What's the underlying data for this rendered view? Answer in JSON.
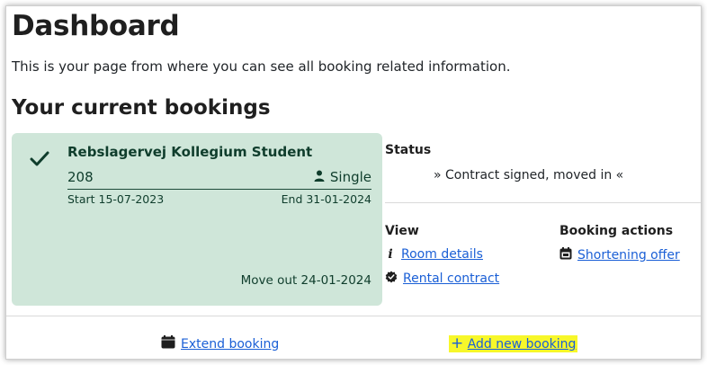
{
  "page": {
    "title": "Dashboard",
    "subtitle": "This is your page from where you can see all booking related information.",
    "section_title": "Your current bookings"
  },
  "booking": {
    "dorm_name": "Rebslagervej Kollegium Student",
    "room_number": "208",
    "room_type": "Single",
    "start": "Start 15-07-2023",
    "end": "End 31-01-2024",
    "move_out": "Move out 24-01-2024",
    "status_icon": "check-icon",
    "card_color": "#cfe6d9"
  },
  "status": {
    "label": "Status",
    "text": "» Contract signed, moved in «"
  },
  "view": {
    "label": "View",
    "room_details": "Room details",
    "rental_contract": "Rental contract"
  },
  "booking_actions": {
    "label": "Booking actions",
    "shortening_offer": "Shortening offer"
  },
  "footer_actions": {
    "extend_booking": "Extend booking",
    "add_new_booking": "Add new booking",
    "add_plus": "+"
  },
  "colors": {
    "link": "#1a5fd6",
    "highlight": "#f7f72a",
    "card_text": "#0f3d2c"
  }
}
